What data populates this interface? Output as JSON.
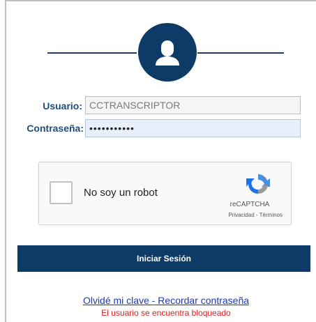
{
  "form": {
    "username_label": "Usuario:",
    "username_value": "CCTRANSCRIPTOR",
    "password_label": "Contraseña:",
    "password_value": "•••••••••••"
  },
  "recaptcha": {
    "checkbox_label": "No soy un robot",
    "brand": "reCAPTCHA",
    "terms": "Privacidad - Términos"
  },
  "actions": {
    "login_label": "Iniciar Sesión",
    "forgot_link": "Olvidé mi clave - Recordar contraseña"
  },
  "status": {
    "error": "El usuario se encuentra bloqueado"
  },
  "icons": {
    "avatar": "user-avatar-icon",
    "recaptcha": "recaptcha-logo-icon"
  },
  "colors": {
    "brand_navy": "#0e3a67",
    "label_blue": "#1f4e79",
    "link_blue": "#1a35c8",
    "error_red": "#e01b1b"
  }
}
